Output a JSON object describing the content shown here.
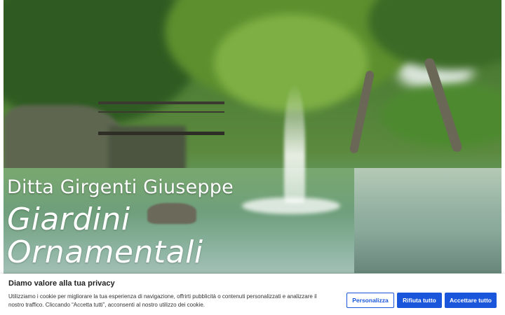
{
  "hero": {
    "subtitle": "Ditta Girgenti Giuseppe",
    "title_line1": "Giardini",
    "title_line2": "Ornamentali"
  },
  "cookie_banner": {
    "title": "Diamo valore alla tua privacy",
    "text": "Utilizziamo i cookie per migliorare la tua esperienza di navigazione, offrirti pubblicità o contenuti personalizzati e analizzare il nostro traffico. Cliccando “Accetta tutti”, acconsenti al nostro utilizzo dei cookie.",
    "buttons": {
      "customize": "Personalizza",
      "reject": "Rifiuta tutto",
      "accept": "Accettare tutto"
    }
  },
  "colors": {
    "accent": "#1a56db"
  }
}
